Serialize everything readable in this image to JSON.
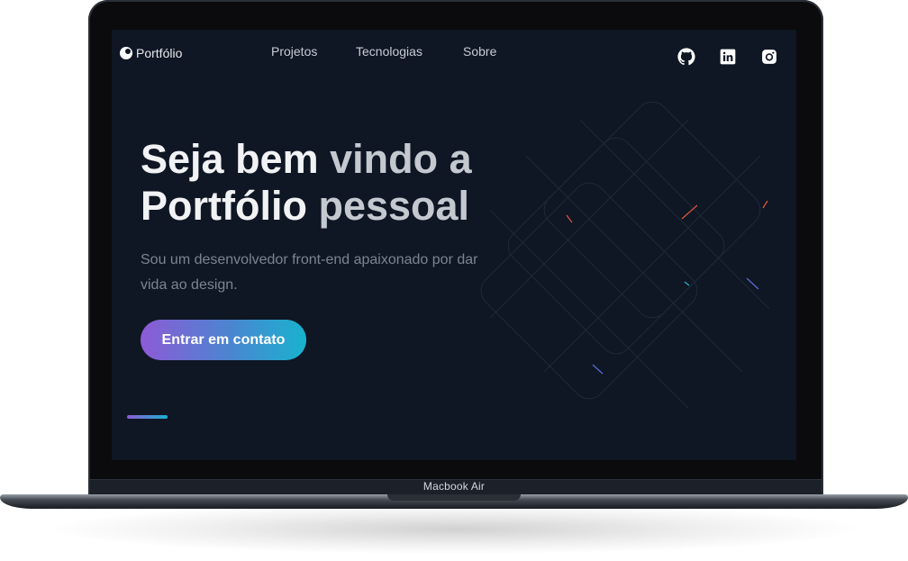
{
  "device": {
    "model_label": "Macbook Air"
  },
  "site": {
    "logo_text": "Portfólio",
    "nav": [
      "Projetos",
      "Tecnologias",
      "Sobre"
    ],
    "social_icons": [
      "github-icon",
      "linkedin-icon",
      "instagram-icon"
    ]
  },
  "hero": {
    "title_line1_bright": "Seja bem ",
    "title_line1_dim": "vindo a",
    "title_line2_bright": "Portfólio ",
    "title_line2_dim": "pessoal",
    "subtitle": "Sou um desenvolvedor front-end apaixonado por dar vida ao design.",
    "cta_label": "Entrar em contato"
  },
  "colors": {
    "screen_bg": "#0f1624",
    "gradient_start": "#8d5ad6",
    "gradient_end": "#18b3cf",
    "text_primary": "#f1f2f4",
    "text_muted": "#7c8492"
  }
}
